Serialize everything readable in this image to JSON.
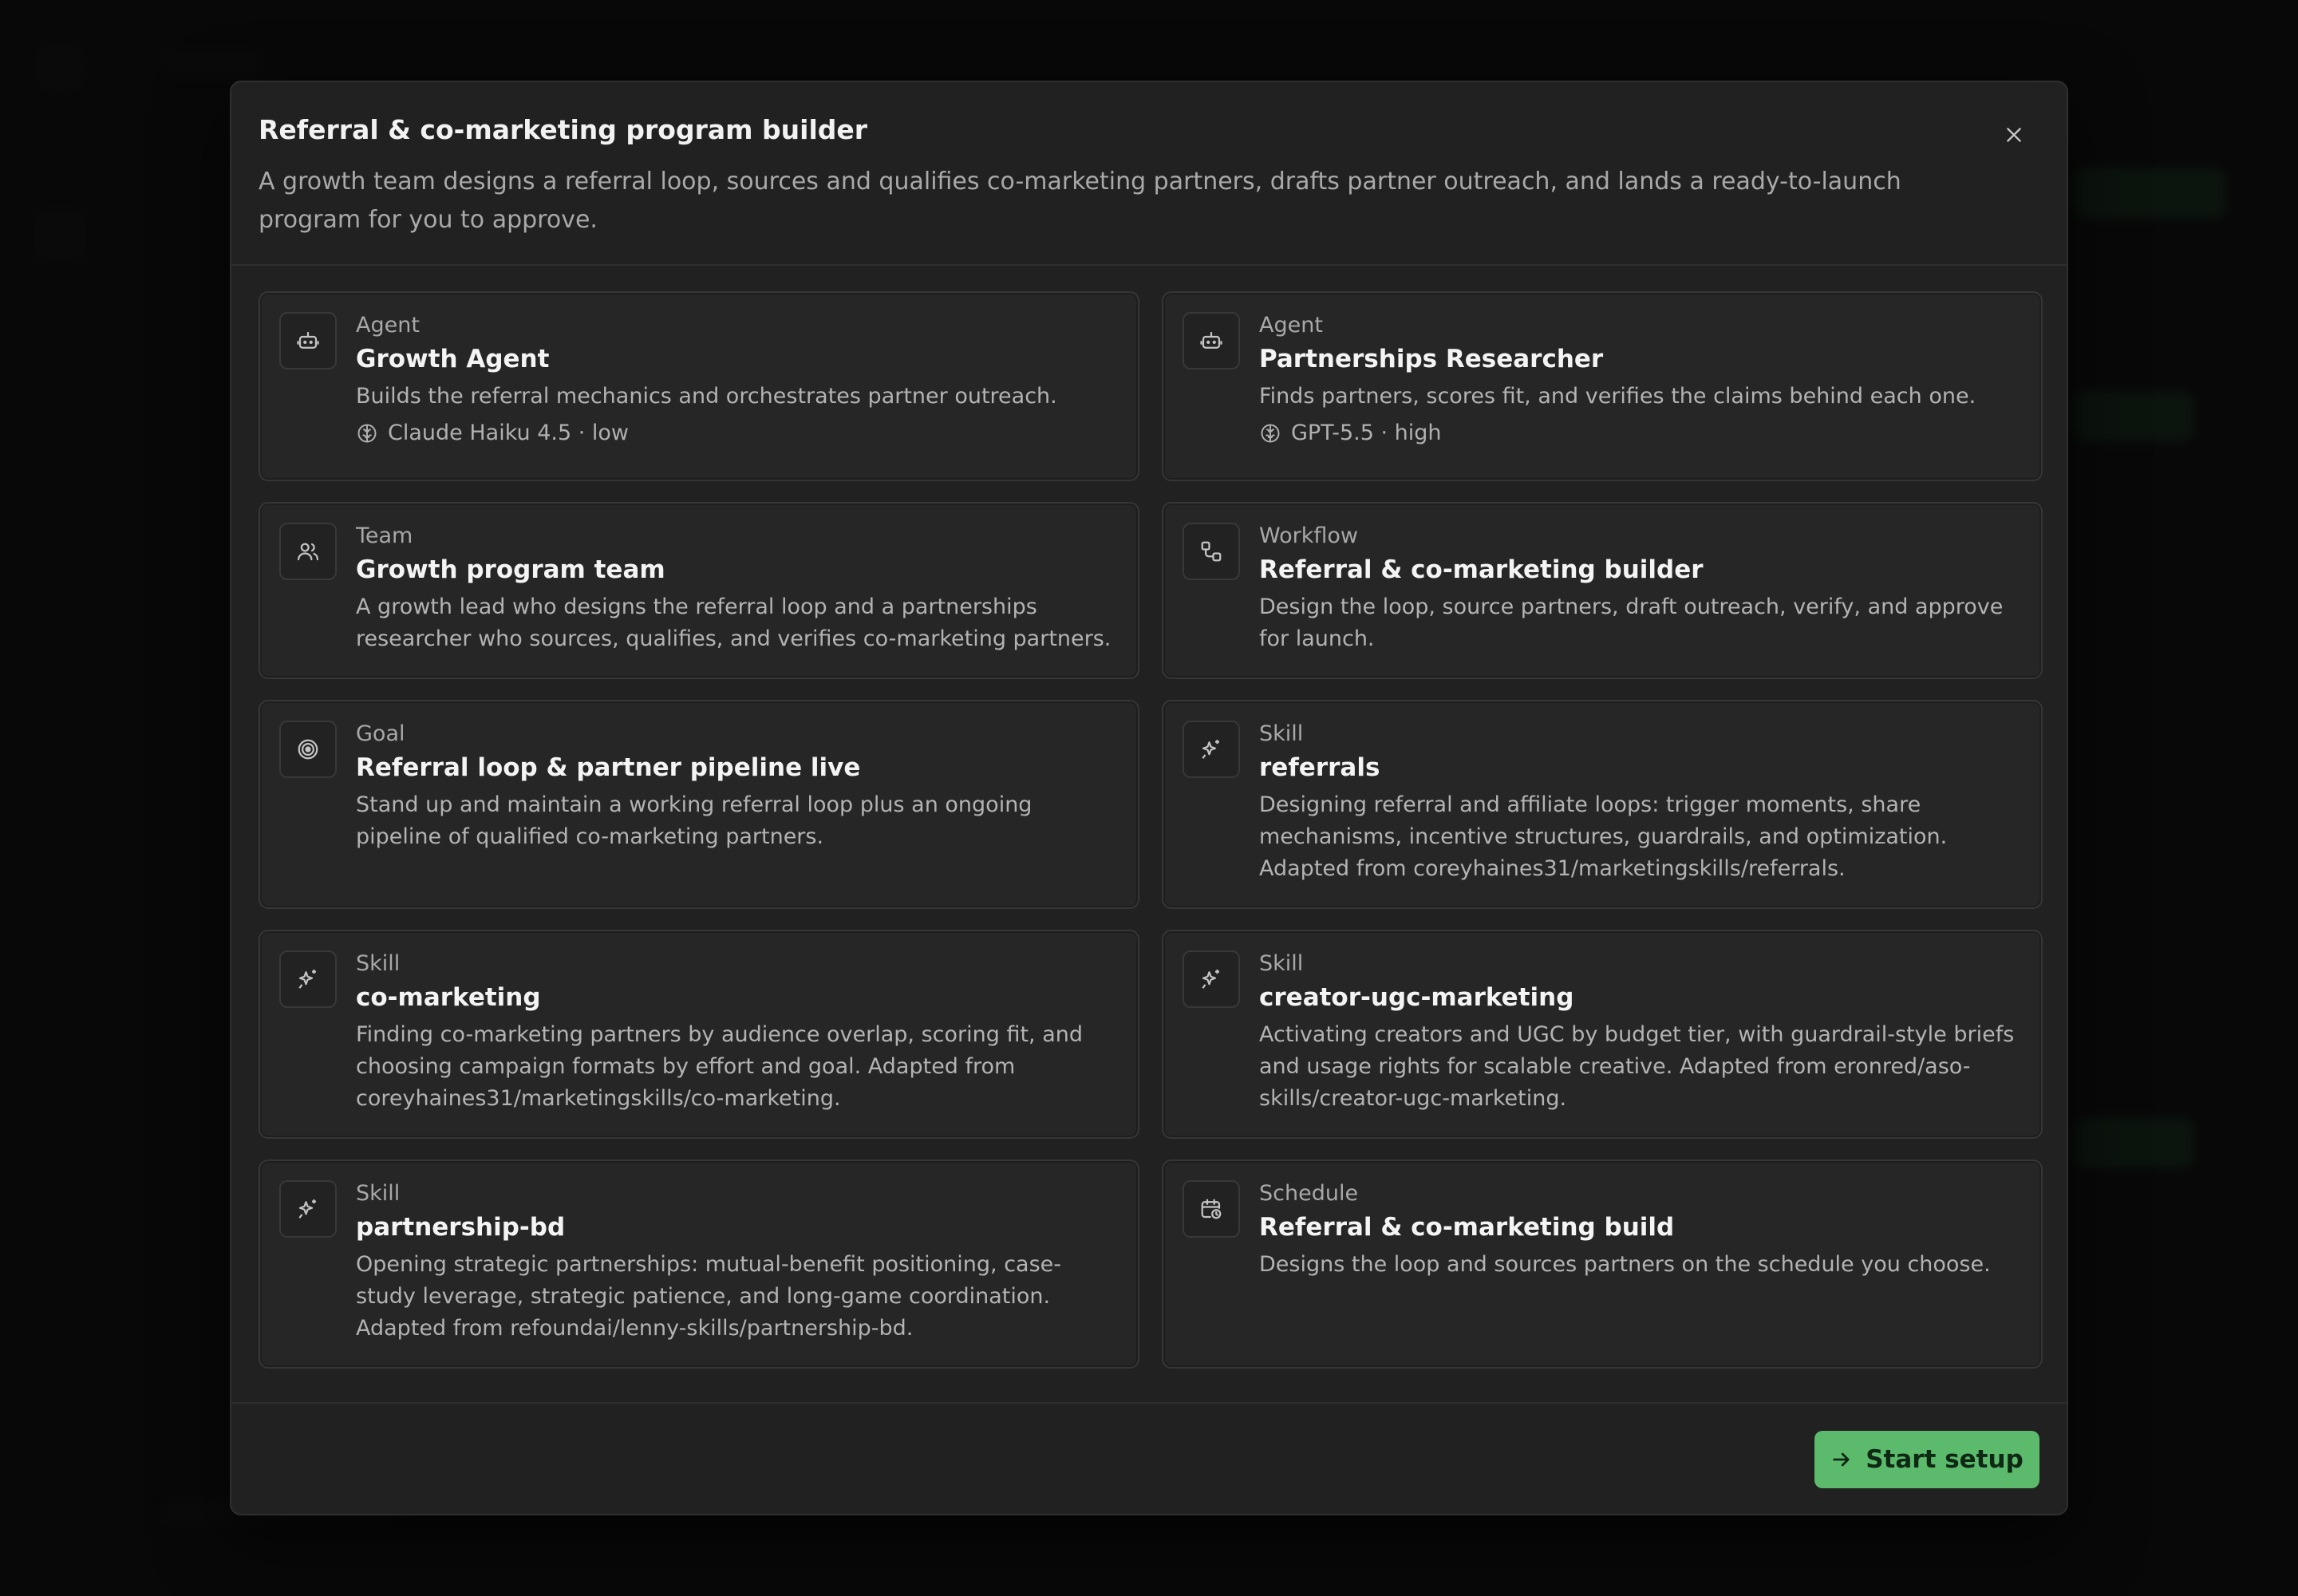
{
  "modal": {
    "title": "Referral & co-marketing program builder",
    "description": "A growth team designs a referral loop, sources and qualifies co-marketing partners, drafts partner outreach, and lands a ready-to-launch program for you to approve.",
    "close_icon": "close-icon"
  },
  "cards": [
    {
      "kind": "Agent",
      "title": "Growth Agent",
      "desc": "Builds the referral mechanics and orchestrates partner outreach.",
      "model": "Claude Haiku 4.5 · low",
      "icon": "robot-icon"
    },
    {
      "kind": "Agent",
      "title": "Partnerships Researcher",
      "desc": "Finds partners, scores fit, and verifies the claims behind each one.",
      "model": "GPT-5.5 · high",
      "icon": "robot-icon"
    },
    {
      "kind": "Team",
      "title": "Growth program team",
      "desc": "A growth lead who designs the referral loop and a partnerships researcher who sources, qualifies, and verifies co-marketing partners.",
      "icon": "users-icon"
    },
    {
      "kind": "Workflow",
      "title": "Referral & co-marketing builder",
      "desc": "Design the loop, source partners, draft outreach, verify, and approve for launch.",
      "icon": "workflow-icon"
    },
    {
      "kind": "Goal",
      "title": "Referral loop & partner pipeline live",
      "desc": "Stand up and maintain a working referral loop plus an ongoing pipeline of qualified co-marketing partners.",
      "icon": "target-icon"
    },
    {
      "kind": "Skill",
      "title": "referrals",
      "desc": "Designing referral and affiliate loops: trigger moments, share mechanisms, incentive structures, guardrails, and optimization. Adapted from coreyhaines31/marketingskills/referrals.",
      "icon": "sparkle-icon"
    },
    {
      "kind": "Skill",
      "title": "co-marketing",
      "desc": "Finding co-marketing partners by audience overlap, scoring fit, and choosing campaign formats by effort and goal. Adapted from coreyhaines31/marketingskills/co-marketing.",
      "icon": "sparkle-icon"
    },
    {
      "kind": "Skill",
      "title": "creator-ugc-marketing",
      "desc": "Activating creators and UGC by budget tier, with guardrail-style briefs and usage rights for scalable creative. Adapted from eronred/aso-skills/creator-ugc-marketing.",
      "icon": "sparkle-icon"
    },
    {
      "kind": "Skill",
      "title": "partnership-bd",
      "desc": "Opening strategic partnerships: mutual-benefit positioning, case-study leverage, strategic patience, and long-game coordination. Adapted from refoundai/lenny-skills/partnership-bd.",
      "icon": "sparkle-icon"
    },
    {
      "kind": "Schedule",
      "title": "Referral & co-marketing build",
      "desc": "Designs the loop and sources partners on the schedule you choose.",
      "icon": "calendar-clock-icon"
    }
  ],
  "footer": {
    "start_label": "Start setup",
    "accent_color": "#5cba6c"
  }
}
